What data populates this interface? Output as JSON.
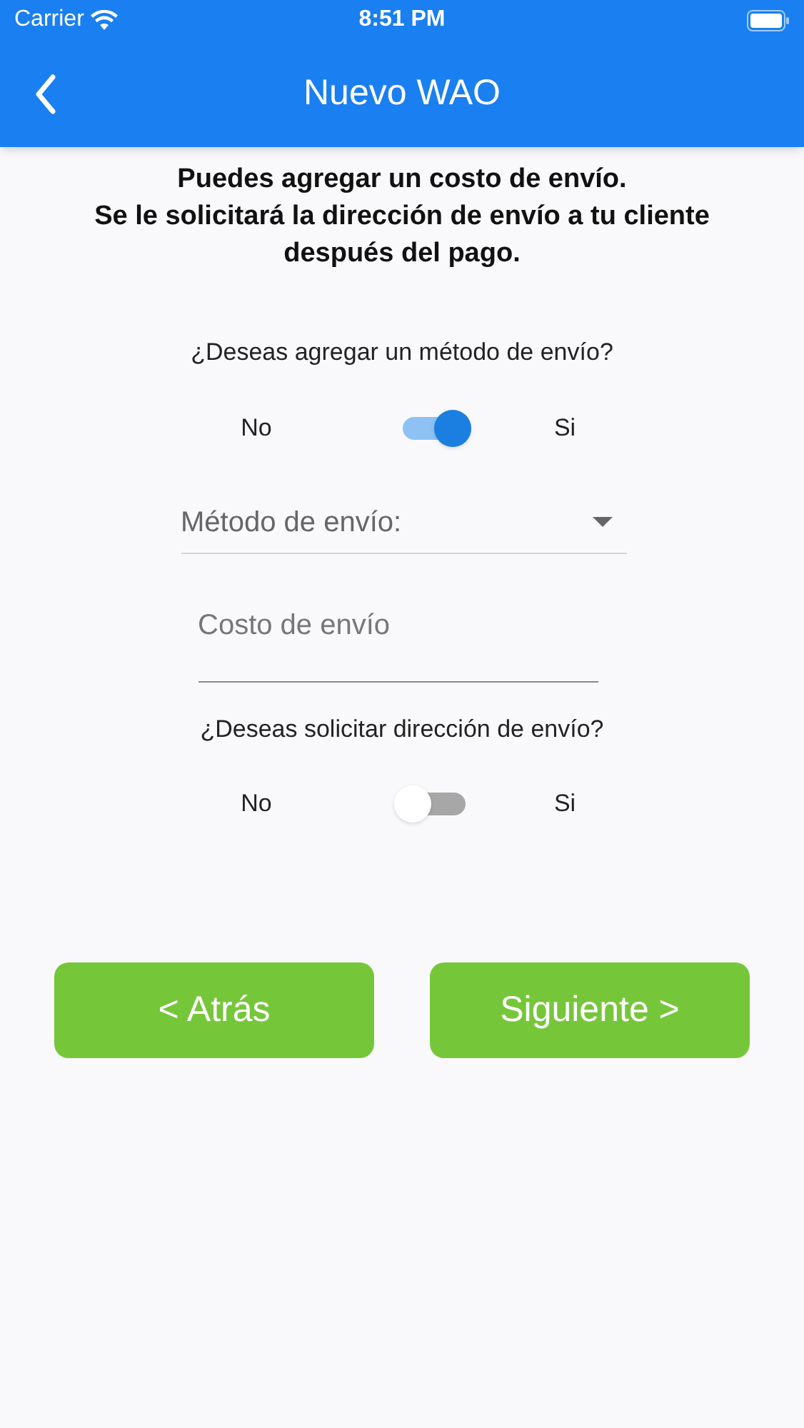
{
  "status_bar": {
    "carrier": "Carrier",
    "time": "8:51 PM"
  },
  "app_bar": {
    "title": "Nuevo WAO"
  },
  "intro": [
    "Puedes agregar un costo de envío.",
    "Se le solicitará la dirección de envío a tu cliente después del pago."
  ],
  "questions": [
    {
      "text": "¿Deseas agregar un método de envío?",
      "off_label": "No",
      "on_label": "Si",
      "on": true
    },
    {
      "text": "¿Deseas solicitar dirección de envío?",
      "off_label": "No",
      "on_label": "Si",
      "on": false
    }
  ],
  "method_dropdown": {
    "placeholder": "Método de envío:"
  },
  "cost_field": {
    "placeholder": "Costo de envío"
  },
  "buttons": [
    "< Atrás",
    "Siguiente >"
  ]
}
